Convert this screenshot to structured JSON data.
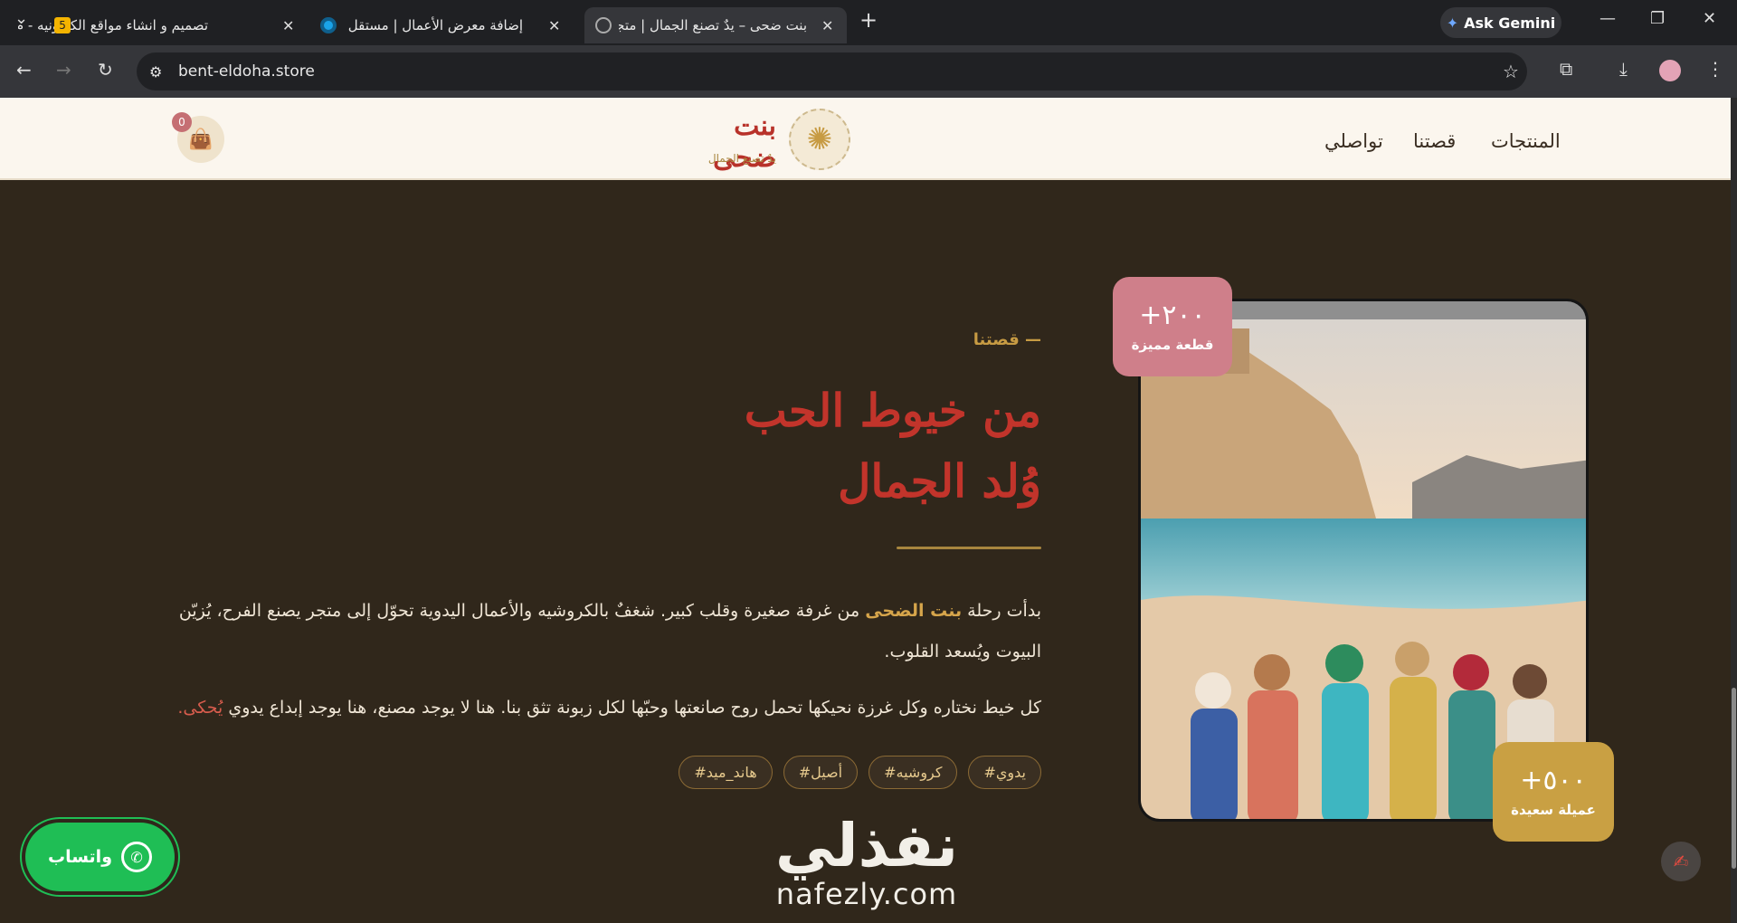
{
  "browser": {
    "tabs": [
      {
        "title": "تصميم و انشاء مواقع الكترونيه - م",
        "badge": "5"
      },
      {
        "title": "إضافة معرض الأعمال | مستقل"
      },
      {
        "title": "بنت ضحى – يدٌ تصنع الجمال | متجر",
        "active": true
      }
    ],
    "new_tab": "+",
    "gemini_label": "Ask Gemini",
    "url": "bent-eldoha.store"
  },
  "header": {
    "menu": [
      "المنتجات",
      "قصتنا",
      "تواصلي"
    ],
    "logo_name": "بنت ضحى",
    "logo_tagline": "يدٌ تصنع الجمال",
    "cart_count": "0"
  },
  "story": {
    "label": "— قصتنا",
    "headline_line1": "من خيوط الحب",
    "headline_line2": "وُلد الجمال",
    "para1_before": "بدأت رحلة ",
    "para1_brand": "بنت الضحى",
    "para1_after": " من غرفة صغيرة وقلب كبير. شغفٌ بالكروشيه والأعمال اليدوية تحوّل إلى متجر يصنع الفرح، يُزيّن البيوت ويُسعد القلوب.",
    "para2_before": "كل خيط نختاره وكل غرزة نحيكها تحمل روح صانعتها وحبّها لكل زبونة تثق بنا. هنا لا يوجد مصنع، هنا يوجد إبداع يدوي ",
    "para2_highlight": "يُحكى.",
    "tags": [
      "#يدوي",
      "#كروشيه",
      "#أصيل",
      "#هاند_ميد"
    ]
  },
  "stats": [
    {
      "value": "+٢٠٠",
      "label": "قطعة مميزة",
      "color": "#cf7f8a"
    },
    {
      "value": "+٥٠٠",
      "label": "عميلة سعيدة",
      "color": "#c9a043"
    }
  ],
  "whatsapp": {
    "label": "واتساب"
  },
  "watermark": {
    "arabic": "نفذلي",
    "latin": "nafezly.com"
  },
  "colors": {
    "brand_red": "#c2342b",
    "gold": "#c79b43",
    "bg": "#30271b"
  }
}
